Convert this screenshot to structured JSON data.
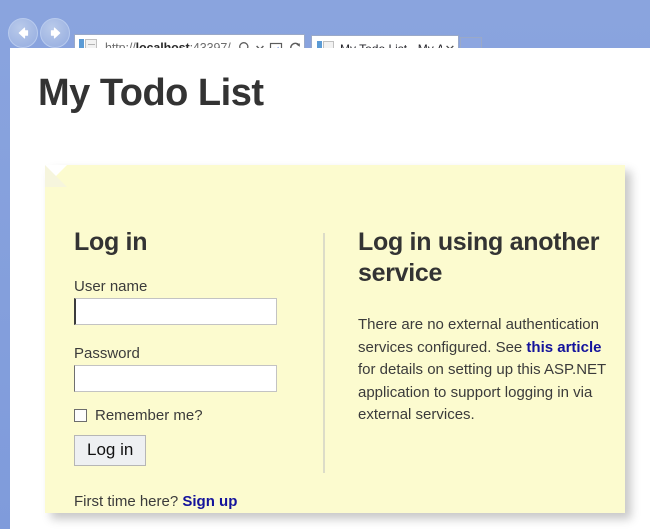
{
  "browser": {
    "back_icon": "back-arrow-icon",
    "forward_icon": "forward-arrow-icon",
    "url_scheme": "http://",
    "url_host": "localhost",
    "url_rest": ":43397/",
    "search_icon": "search-icon",
    "caret_icon": "chevron-down-icon",
    "compat_icon": "compatibility-view-icon",
    "refresh_icon": "refresh-icon",
    "tab": {
      "title": "My Todo List - My A...",
      "close_label": "✕",
      "favicon": "page-favicon-icon"
    },
    "new_tab_label": ""
  },
  "page": {
    "title": "My Todo List"
  },
  "login": {
    "heading": "Log in",
    "username_label": "User name",
    "username_value": "",
    "username_placeholder": "",
    "password_label": "Password",
    "password_value": "",
    "password_placeholder": "",
    "remember_label": "Remember me?",
    "remember_checked": false,
    "submit_label": "Log in"
  },
  "external": {
    "heading": "Log in using another service",
    "text_before": "There are no external authentication services configured. See ",
    "link_label": "this article",
    "text_after": " for details on setting up this ASP.NET application to support logging in via external services."
  },
  "signup": {
    "prompt": "First time here? ",
    "link_label": "Sign up"
  },
  "colors": {
    "chrome_blue": "#7f9bdb",
    "panel_yellow": "#fcfbcf",
    "link_navy": "#14139c",
    "heading_gray": "#333333"
  }
}
